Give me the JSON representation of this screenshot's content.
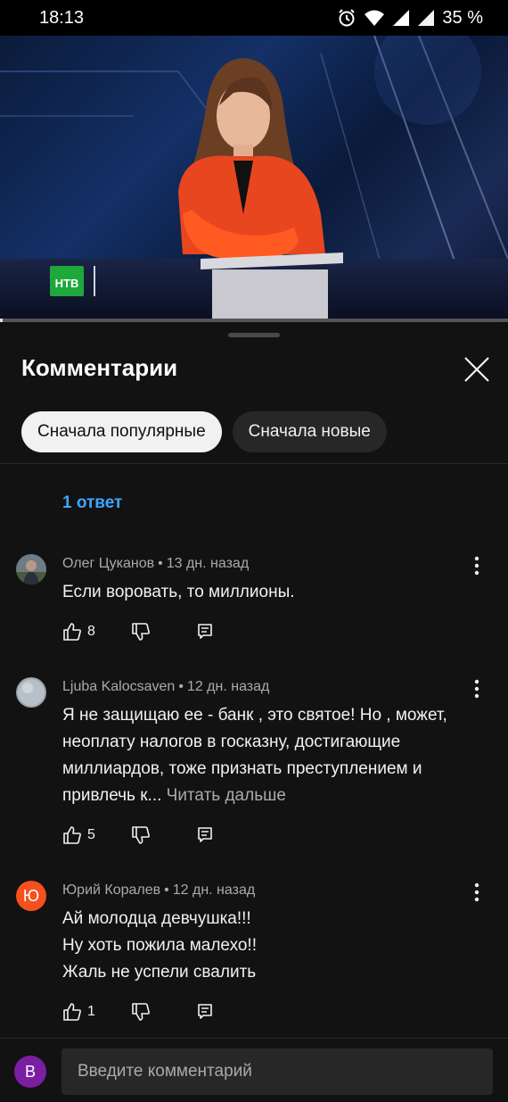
{
  "status_bar": {
    "time": "18:13",
    "battery": "35 %",
    "icons": [
      "alarm-icon",
      "wifi-icon",
      "signal-icon",
      "signal-icon",
      "battery-label"
    ]
  },
  "video": {
    "channel_logo": "НТВ",
    "progress_fraction": 0.005
  },
  "comments_panel": {
    "title": "Комментарии",
    "close_icon": "close-icon",
    "sort_chips": [
      {
        "label": "Сначала популярные",
        "selected": true
      },
      {
        "label": "Сначала новые",
        "selected": false
      }
    ],
    "replies_link": "1 ответ",
    "comments": [
      {
        "author": "Олег Цуканов",
        "time": "13 дн. назад",
        "text": "Если воровать, то миллионы.",
        "likes": "8",
        "read_more": ""
      },
      {
        "author": "Ljuba Kalocsaven",
        "time": "12 дн. назад",
        "text": "Я не защищаю ее - банк , это святое! Но , может, неоплату налогов в госказну, достигающие миллиардов, тоже признать преступлением и привлечь к...",
        "likes": "5",
        "read_more": "Читать дальше"
      },
      {
        "author": "Юрий Коралев",
        "time": "12 дн. назад",
        "text_lines": [
          "Ай молодца девчушка!!!",
          "Ну хоть пожила малехо!!",
          "Жаль не успели свалить"
        ],
        "likes": "1",
        "avatar_letter": "Ю",
        "avatar_color": "#f4511e"
      }
    ]
  },
  "composer": {
    "avatar_letter": "В",
    "avatar_color": "#7b1fa2",
    "placeholder": "Введите комментарий"
  },
  "colors": {
    "background": "#0f0f0f",
    "link": "#3ea6ff",
    "secondary_text": "#aaaaaa"
  }
}
